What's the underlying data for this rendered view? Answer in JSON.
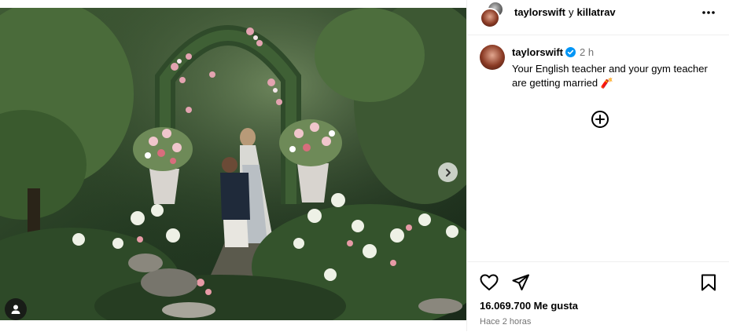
{
  "header": {
    "user_primary": "taylorswift",
    "connector": "y",
    "user_secondary": "killatrav",
    "more_icon": "more-horizontal-icon"
  },
  "caption": {
    "username": "taylorswift",
    "verified": true,
    "time": "2 h",
    "text": "Your English teacher and your gym teacher are getting married 🧨"
  },
  "actions": {
    "like_icon": "heart-icon",
    "share_icon": "paper-plane-icon",
    "save_icon": "bookmark-icon",
    "add_icon": "plus-circle-icon"
  },
  "stats": {
    "likes": "16.069.700 Me gusta",
    "posted": "Hace 2 horas"
  },
  "colors": {
    "verified": "#0095f6",
    "secondary_text": "#737373",
    "divider": "#efefef"
  }
}
